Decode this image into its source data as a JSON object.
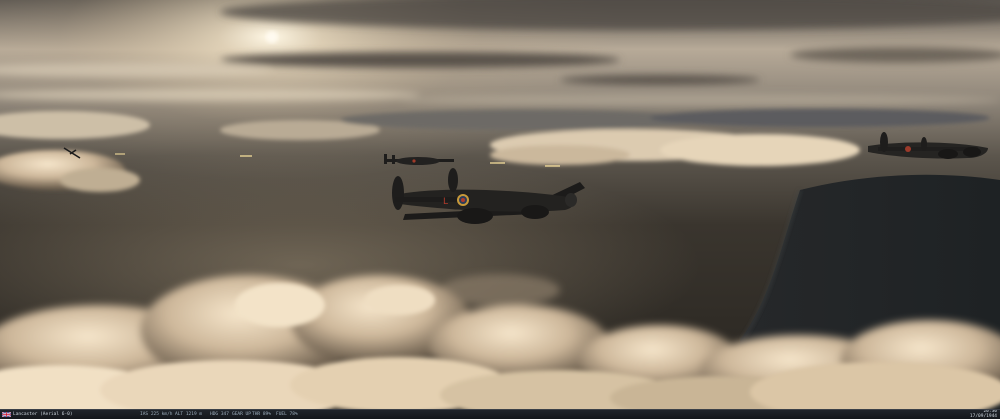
{
  "scene": {
    "description_icon": "bomber-formation-scene"
  },
  "hud": {
    "aircraft_name": "Lancaster (Aerial 6-0)",
    "flag_icon": "uk-flag-icon",
    "readouts": [
      "IAS 225 km/h",
      "ALT 1219 m",
      "HDG 347",
      "GEAR UP",
      "THR 89%",
      "FUEL 78%"
    ],
    "time": "20:30",
    "date": "17/09/1944"
  },
  "colors": {
    "sky_top": "#6b6660",
    "sun": "#fff4dc",
    "sea": "#2c2924",
    "cloud_light": "#f1dfc3",
    "cloud_shadow": "#7a6a58",
    "bomber": "#1f1f1f",
    "roundel_red": "#b03a2a"
  }
}
